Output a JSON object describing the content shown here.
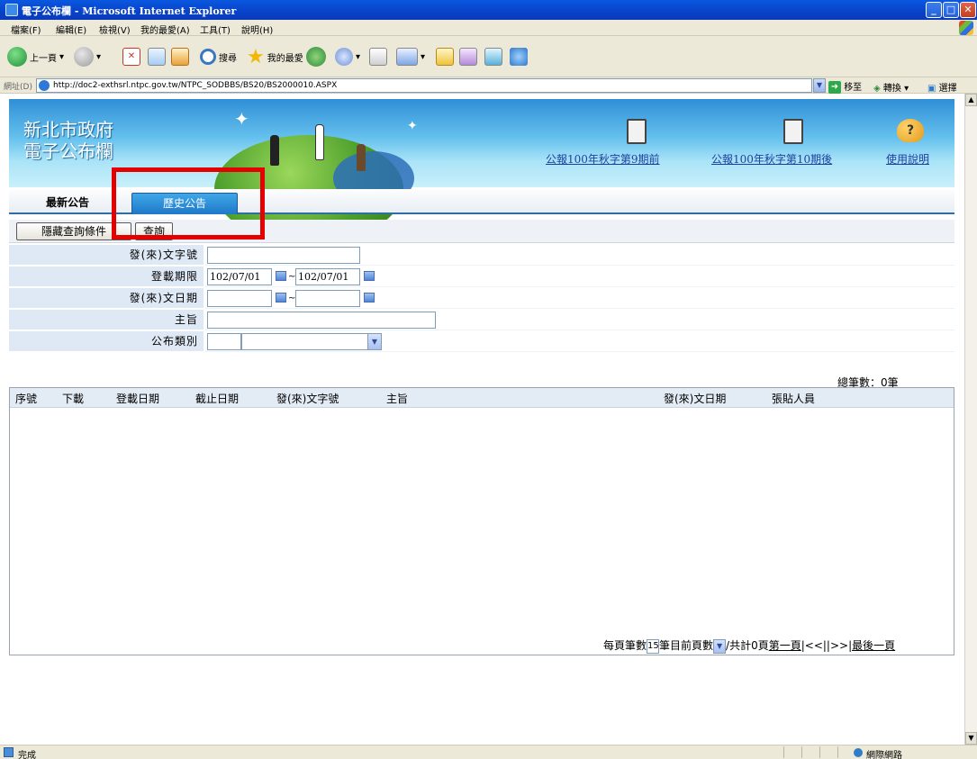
{
  "window": {
    "title": "電子公布欄 - Microsoft Internet Explorer",
    "min_label": "_",
    "max_label": "□",
    "close_label": "✕"
  },
  "menu": [
    "檔案(F)",
    "編輯(E)",
    "檢視(V)",
    "我的最愛(A)",
    "工具(T)",
    "說明(H)"
  ],
  "toolbar": {
    "back_label": "上一頁",
    "search_label": "搜尋",
    "favorites_label": "我的最愛"
  },
  "address": {
    "label": "網址(D)",
    "url": "http://doc2-exthsrl.ntpc.gov.tw/NTPC_SODBBS/BS20/BS2000010.ASPX",
    "go_label": "移至",
    "translate_label": "轉換",
    "select_label": "選擇"
  },
  "site": {
    "title_line1": "新北市政府",
    "title_line2": "電子公布欄",
    "link_prev": "公報100年秋字第9期前",
    "link_next": "公報100年秋字第10期後",
    "link_help": "使用說明"
  },
  "tabs": {
    "latest": "最新公告",
    "history": "歷史公告"
  },
  "buttons": {
    "hide_conditions": "隱藏查詢條件",
    "query": "查詢"
  },
  "form": {
    "doc_no_label": "發(來)文字號",
    "period_label": "登載期限",
    "period_start": "102/07/01",
    "period_end": "102/07/01",
    "doc_date_label": "發(來)文日期",
    "subject_label": "主旨",
    "category_label": "公布類別",
    "range_sep": "~"
  },
  "results": {
    "total": "總筆數：0筆",
    "columns": [
      "序號",
      "下載",
      "登載日期",
      "截止日期",
      "發(來)文字號",
      "主旨",
      "發(來)文日期",
      "張貼人員"
    ]
  },
  "pager": {
    "per_page_label": "每頁筆數",
    "per_page_value": "15",
    "current_label": "筆目前頁數",
    "total_label": "/共計0頁",
    "first": "第一頁",
    "nav": "|<<||>>|",
    "last": "最後一頁"
  },
  "status": {
    "text": "完成",
    "zone": "網際網路"
  }
}
